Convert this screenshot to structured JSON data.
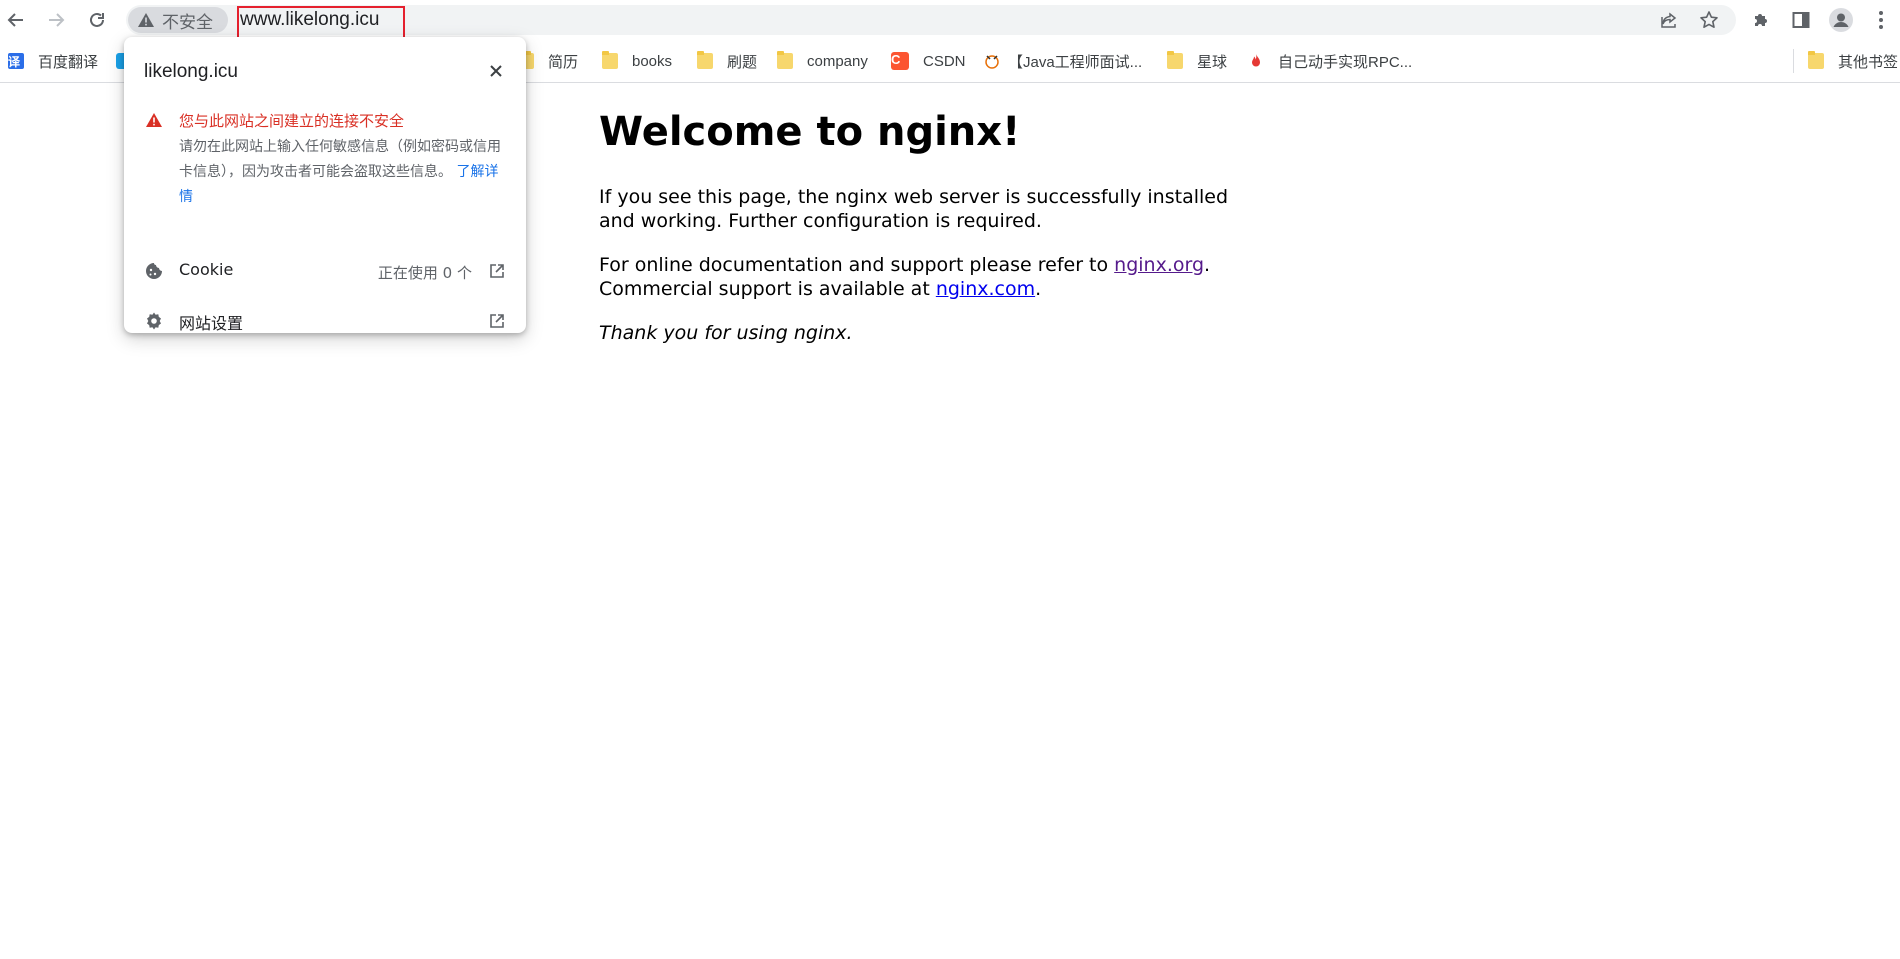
{
  "browser": {
    "security_label": "不安全",
    "url": "www.likelong.icu",
    "icons": {
      "back": "arrow-left-icon",
      "forward": "arrow-right-icon",
      "reload": "reload-icon",
      "share": "share-icon",
      "bookmark": "star-icon",
      "extensions": "puzzle-icon",
      "side_panel": "side-panel-icon",
      "profile": "avatar-icon",
      "menu": "kebab-menu-icon"
    },
    "accent_highlight": "#e5202e"
  },
  "bookmarks": {
    "items": [
      {
        "label": "百度翻译",
        "icon": "fanyi-icon",
        "icon_text": "译"
      },
      {
        "label": "简历",
        "icon": "folder-icon"
      },
      {
        "label": "books",
        "icon": "folder-icon"
      },
      {
        "label": "刷题",
        "icon": "folder-icon"
      },
      {
        "label": "company",
        "icon": "folder-icon"
      },
      {
        "label": "CSDN",
        "icon": "csdn-icon",
        "icon_text": "C"
      },
      {
        "label": "【Java工程师面试...",
        "icon": "site-icon"
      },
      {
        "label": "星球",
        "icon": "folder-icon"
      },
      {
        "label": "自己动手实现RPC...",
        "icon": "flame-icon"
      }
    ],
    "other": {
      "label": "其他书签",
      "icon": "folder-icon"
    }
  },
  "site_info_popup": {
    "site": "likelong.icu",
    "warning_title": "您与此网站之间建立的连接不安全",
    "warning_body": "请勿在此网站上输入任何敏感信息（例如密码或信用卡信息），因为攻击者可能会盗取这些信息。",
    "learn_more": "了解详情",
    "cookie_label": "Cookie",
    "cookie_value": "正在使用 0 个",
    "site_settings_label": "网站设置",
    "warning_color": "#d93025"
  },
  "page": {
    "heading": "Welcome to nginx!",
    "p1": "If you see this page, the nginx web server is successfully installed and working. Further configuration is required.",
    "p2_before": "For online documentation and support please refer to ",
    "link1": "nginx.org",
    "p2_middle": ".",
    "p2_line2": "Commercial support is available at ",
    "link2": "nginx.com",
    "p2_end": ".",
    "p3": "Thank you for using nginx."
  }
}
